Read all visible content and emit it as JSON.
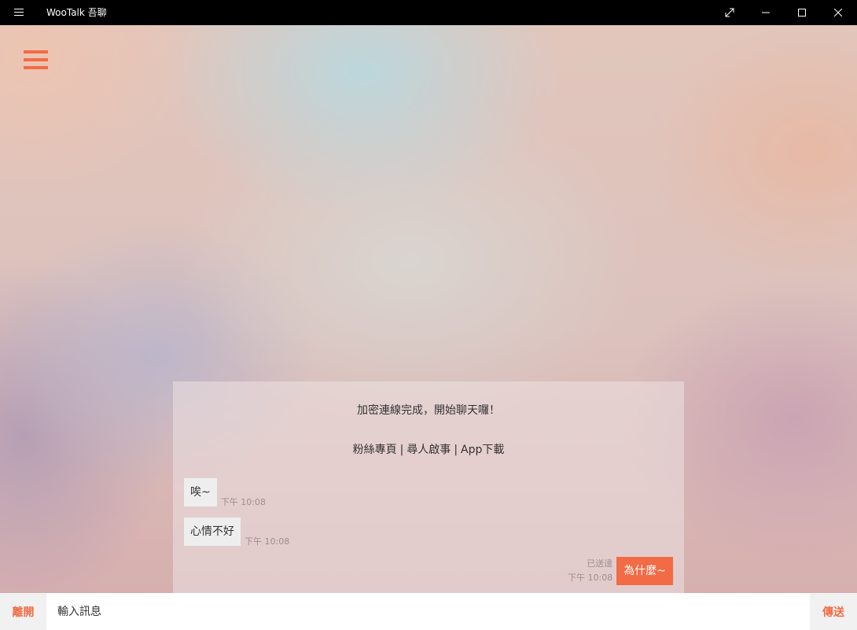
{
  "window": {
    "title": "WooTalk 吾聊",
    "icons": {
      "hamburger": "hamburger-icon",
      "fullscreen": "fullscreen-icon",
      "minimize": "minimize-icon",
      "maximize": "maximize-icon",
      "close": "close-icon"
    }
  },
  "app": {
    "menu_icon": "menu-icon",
    "accent_color": "#f26b45"
  },
  "chat": {
    "system_message": "加密連線完成，開始聊天囉！",
    "links": [
      {
        "label": "粉絲專頁"
      },
      {
        "label": "尋人啟事"
      },
      {
        "label": "App下載"
      }
    ],
    "link_separator": "|",
    "messages": [
      {
        "direction": "incoming",
        "text": "唉~",
        "time": "下午 10:08"
      },
      {
        "direction": "incoming",
        "text": "心情不好",
        "time": "下午 10:08"
      },
      {
        "direction": "outgoing",
        "text": "為什麼~",
        "status": "已送達",
        "time": "下午 10:08"
      }
    ]
  },
  "input_bar": {
    "leave_label": "離開",
    "placeholder": "輸入訊息",
    "send_label": "傳送"
  }
}
